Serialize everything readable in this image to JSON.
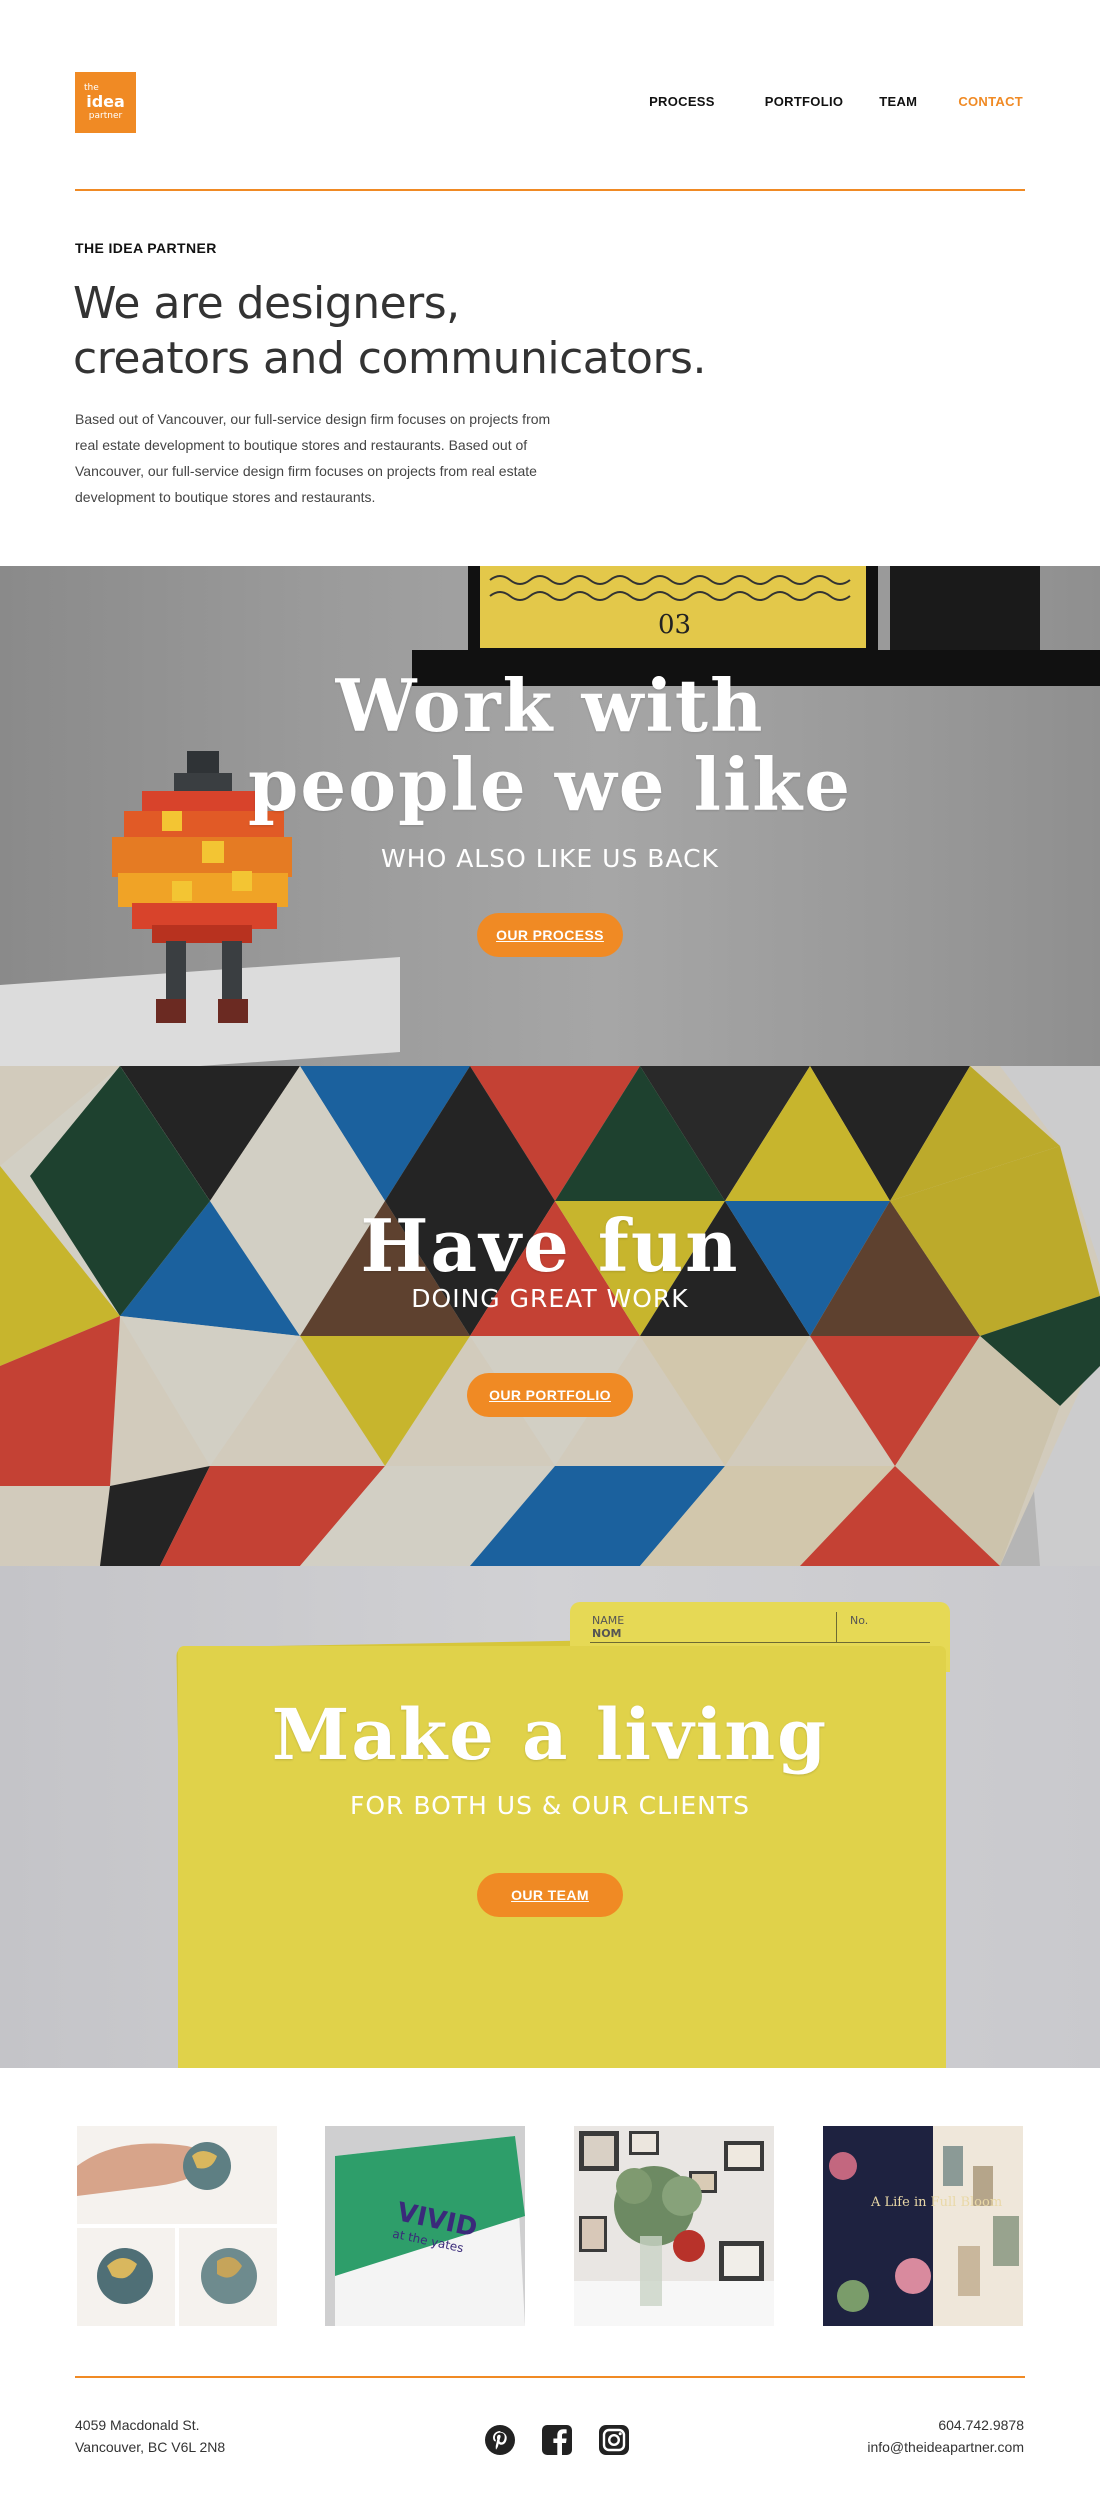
{
  "brand": {
    "logo_top": "the",
    "logo_mid": "idea",
    "logo_bottom": "partner",
    "accent_color": "#F08A24"
  },
  "nav": {
    "items": [
      {
        "label": "PROCESS"
      },
      {
        "label": "PORTFOLIO"
      },
      {
        "label": "TEAM"
      },
      {
        "label": "CONTACT",
        "active": true
      }
    ]
  },
  "intro": {
    "eyebrow": "THE IDEA PARTNER",
    "heading_line1": "We are designers,",
    "heading_line2": "creators and communicators.",
    "body": "Based out of Vancouver, our full-service design firm focuses on projects from real estate development to boutique stores and restaurants. Based out of Vancouver, our full-service design firm focuses on projects from real estate development to boutique stores and restaurants."
  },
  "panels": [
    {
      "headline_line1": "Work with",
      "headline_line2": "people we like",
      "subheading": "WHO ALSO LIKE US BACK",
      "button": "OUR PROCESS",
      "poster_number": "03"
    },
    {
      "headline": "Have fun",
      "subheading": "DOING GREAT WORK",
      "button": "OUR PORTFOLIO"
    },
    {
      "headline": "Make a living",
      "subheading": "FOR BOTH US & OUR CLIENTS",
      "button": "OUR TEAM",
      "folder_label_name": "NAME",
      "folder_label_nom": "NOM",
      "folder_label_no": "No."
    }
  ],
  "gallery": {
    "book_title": "VIVID",
    "book_subtitle": "at the yates",
    "book2_title": "A Life in Full Bloom"
  },
  "footer": {
    "address_line1": "4059  Macdonald St.",
    "address_line2": "Vancouver, BC V6L 2N8",
    "phone": "604.742.9878",
    "email": "info@theideapartner.com",
    "social": [
      "pinterest-icon",
      "facebook-icon",
      "instagram-icon"
    ]
  }
}
